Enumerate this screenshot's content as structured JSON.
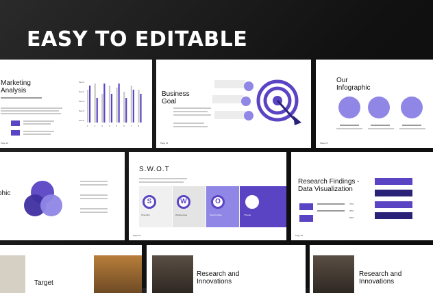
{
  "headline": "EASY TO EDITABLE",
  "colors": {
    "accent": "#5b44c4",
    "accent_light": "#8f86e6",
    "background": "#151515"
  },
  "slides": {
    "marketing": {
      "title": "Marketing Analysis",
      "page": "Page 21",
      "bar_labels": [
        "Text 0",
        "Text 0",
        "Text 0",
        "Text 0",
        "Text 0"
      ]
    },
    "business": {
      "title": "Business Goal",
      "page": "Page 22"
    },
    "infographic": {
      "title": "Our Infographic",
      "page": "Page 23"
    },
    "graphic": {
      "title": "phic"
    },
    "swot": {
      "title": "S.W.O.T",
      "page": "Page 25",
      "items": [
        {
          "letter": "S",
          "label": "Strengths"
        },
        {
          "letter": "W",
          "label": "Weaknesses"
        },
        {
          "letter": "O",
          "label": "Opportunities"
        },
        {
          "letter": "T",
          "label": "Threats"
        }
      ]
    },
    "research": {
      "title": "Research Findings - Data Visualization",
      "page": "Page 26",
      "percentages": [
        "75%",
        "25%",
        "55%"
      ]
    },
    "target": {
      "title": "Target"
    },
    "innovations1": {
      "title": "Research and Innovations"
    },
    "innovations2": {
      "title": "Research and Innovations"
    }
  },
  "marketing_chart": {
    "type": "bar",
    "categories": [
      "1",
      "2",
      "3",
      "4",
      "5",
      "6",
      "7",
      "8"
    ],
    "series": [
      {
        "values": [
          0.8,
          0.95,
          0.7,
          0.9,
          0.85,
          0.75,
          0.9,
          0.8
        ]
      },
      {
        "values": [
          0.9,
          0.6,
          0.95,
          0.7,
          0.95,
          0.6,
          0.8,
          0.7
        ]
      }
    ]
  }
}
